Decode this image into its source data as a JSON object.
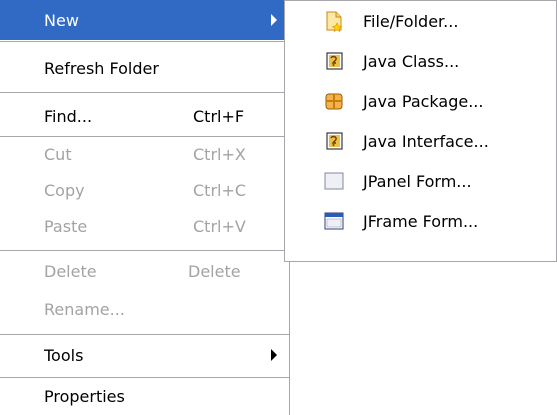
{
  "context_menu": {
    "new": {
      "label": "New"
    },
    "refresh_folder": {
      "label": "Refresh Folder"
    },
    "find": {
      "label": "Find...",
      "shortcut": "Ctrl+F"
    },
    "cut": {
      "label": "Cut",
      "shortcut": "Ctrl+X"
    },
    "copy": {
      "label": "Copy",
      "shortcut": "Ctrl+C"
    },
    "paste": {
      "label": "Paste",
      "shortcut": "Ctrl+V"
    },
    "delete": {
      "label": "Delete",
      "shortcut": "Delete"
    },
    "rename": {
      "label": "Rename..."
    },
    "tools": {
      "label": "Tools"
    },
    "properties": {
      "label": "Properties"
    }
  },
  "new_submenu": {
    "items": [
      {
        "label": "File/Folder...",
        "icon": "new-file-icon"
      },
      {
        "label": "Java Class...",
        "icon": "java-class-icon"
      },
      {
        "label": "Java Package...",
        "icon": "java-package-icon"
      },
      {
        "label": "Java Interface...",
        "icon": "java-interface-icon"
      },
      {
        "label": "JPanel Form...",
        "icon": "jpanel-form-icon"
      },
      {
        "label": "JFrame Form...",
        "icon": "jframe-form-icon"
      }
    ]
  },
  "colors": {
    "selection": "#316ac5",
    "disabled_text": "#a3a3a3",
    "separator": "#a7a6aa"
  }
}
